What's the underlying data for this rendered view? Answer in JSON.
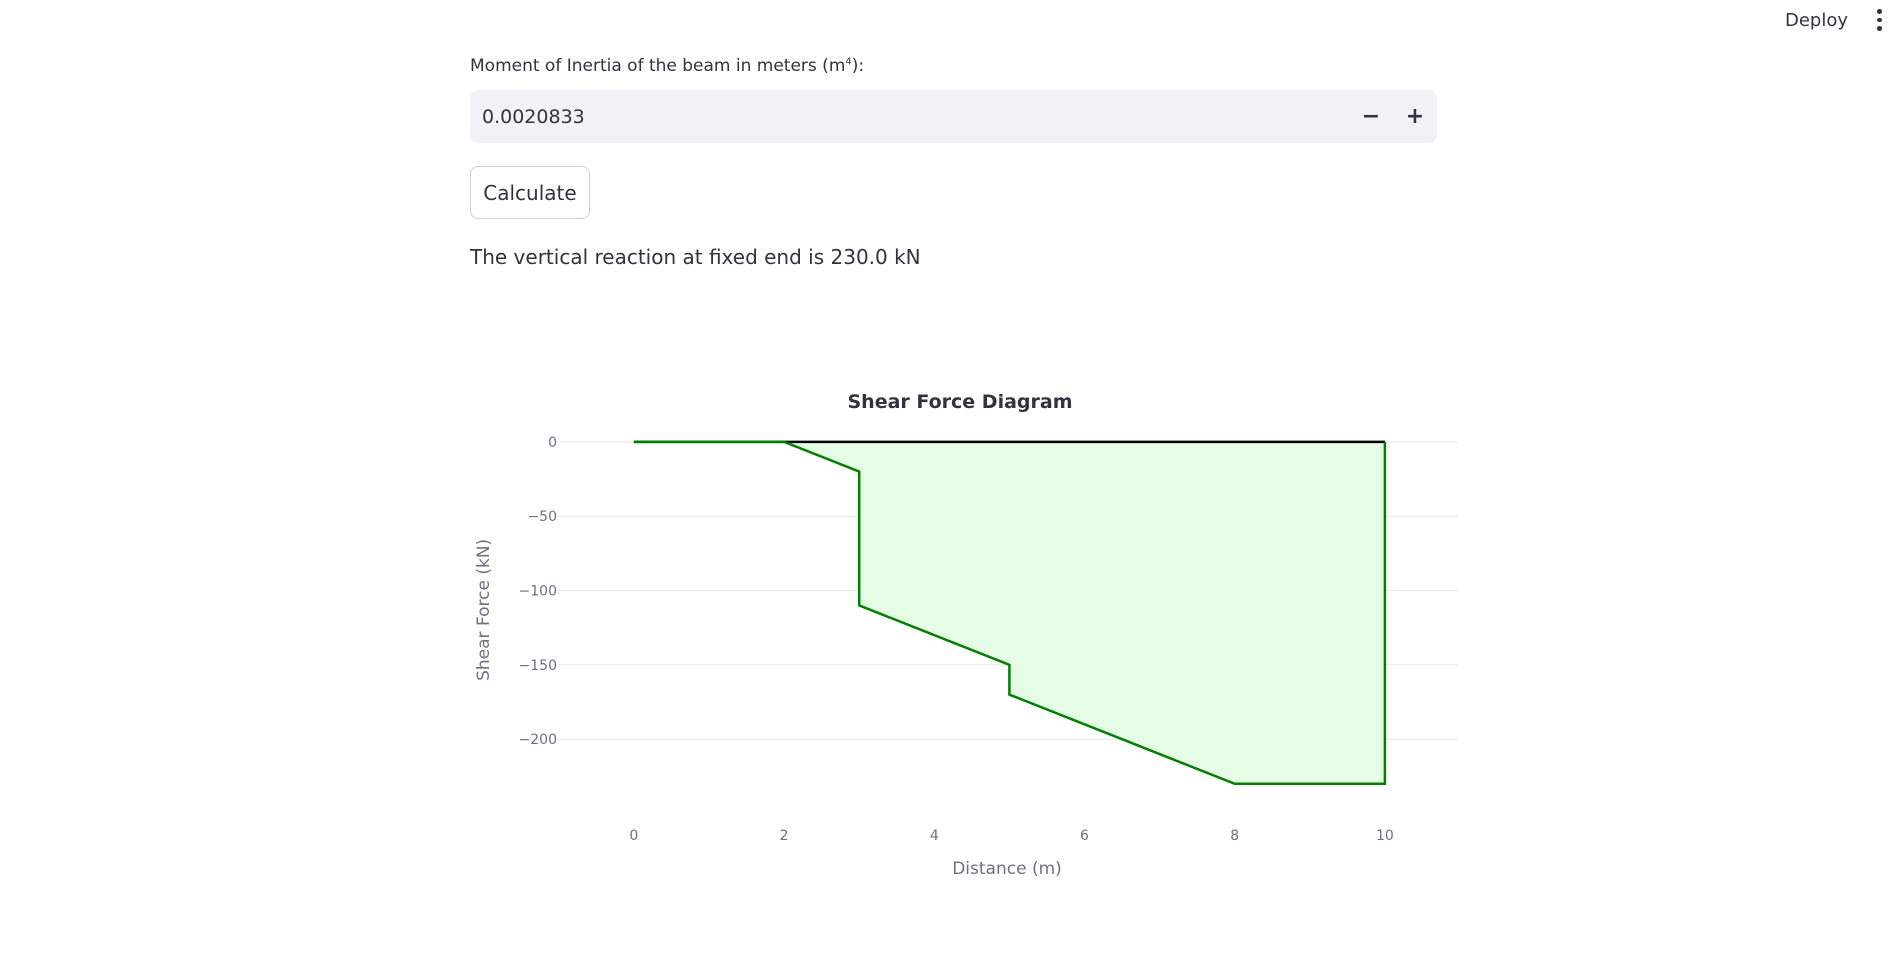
{
  "header": {
    "deploy_label": "Deploy",
    "menu_icon": "vertical-dots-icon"
  },
  "inertia_field": {
    "label": "Moment of Inertia of the beam in meters (m",
    "label_sup": "4",
    "label_suffix": "):",
    "value": "0.0020833",
    "decrement_label": "−",
    "increment_label": "+"
  },
  "calculate_label": "Calculate",
  "result_text": "The vertical reaction at fixed end is 230.0 kN",
  "chart_data": {
    "type": "area",
    "title": "Shear Force Diagram",
    "xlabel": "Distance (m)",
    "ylabel": "Shear Force (kN)",
    "x_ticks": [
      0,
      2,
      4,
      6,
      8,
      10
    ],
    "y_ticks": [
      0,
      -50,
      -100,
      -150,
      -200
    ],
    "x_tick_labels": [
      "0",
      "2",
      "4",
      "6",
      "8",
      "10"
    ],
    "y_tick_labels": [
      "0",
      "−50",
      "−100",
      "−150",
      "−200"
    ],
    "xlim": [
      -1.05,
      11.0
    ],
    "ylim": [
      -251,
      8
    ],
    "grid": true,
    "line_color": "#008000",
    "fill_color": "#e5fce5",
    "baseline_color": "#000000",
    "baseline": {
      "x": [
        0,
        10
      ],
      "y": [
        0,
        0
      ]
    },
    "series": [
      {
        "x": [
          0,
          2,
          3,
          3,
          5,
          5,
          8,
          10,
          10
        ],
        "y": [
          0,
          0,
          -20,
          -110,
          -150,
          -170,
          -230,
          -230,
          0
        ]
      }
    ]
  }
}
